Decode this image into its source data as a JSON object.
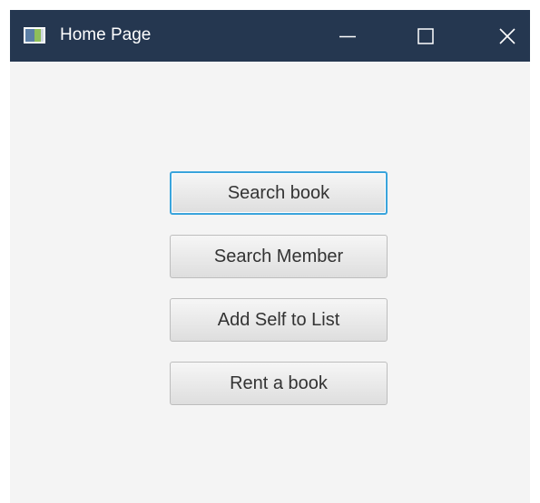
{
  "window": {
    "title": "Home Page",
    "titlebar_color": "#253750",
    "background_color": "#f4f4f4",
    "controls": [
      "minimize-icon",
      "maximize-icon",
      "close-icon"
    ]
  },
  "buttons": [
    {
      "label": "Search book",
      "focused": true
    },
    {
      "label": "Search Member",
      "focused": false
    },
    {
      "label": "Add Self to List",
      "focused": false
    },
    {
      "label": "Rent a book",
      "focused": false
    }
  ],
  "focus_color": "#3aa4dc"
}
